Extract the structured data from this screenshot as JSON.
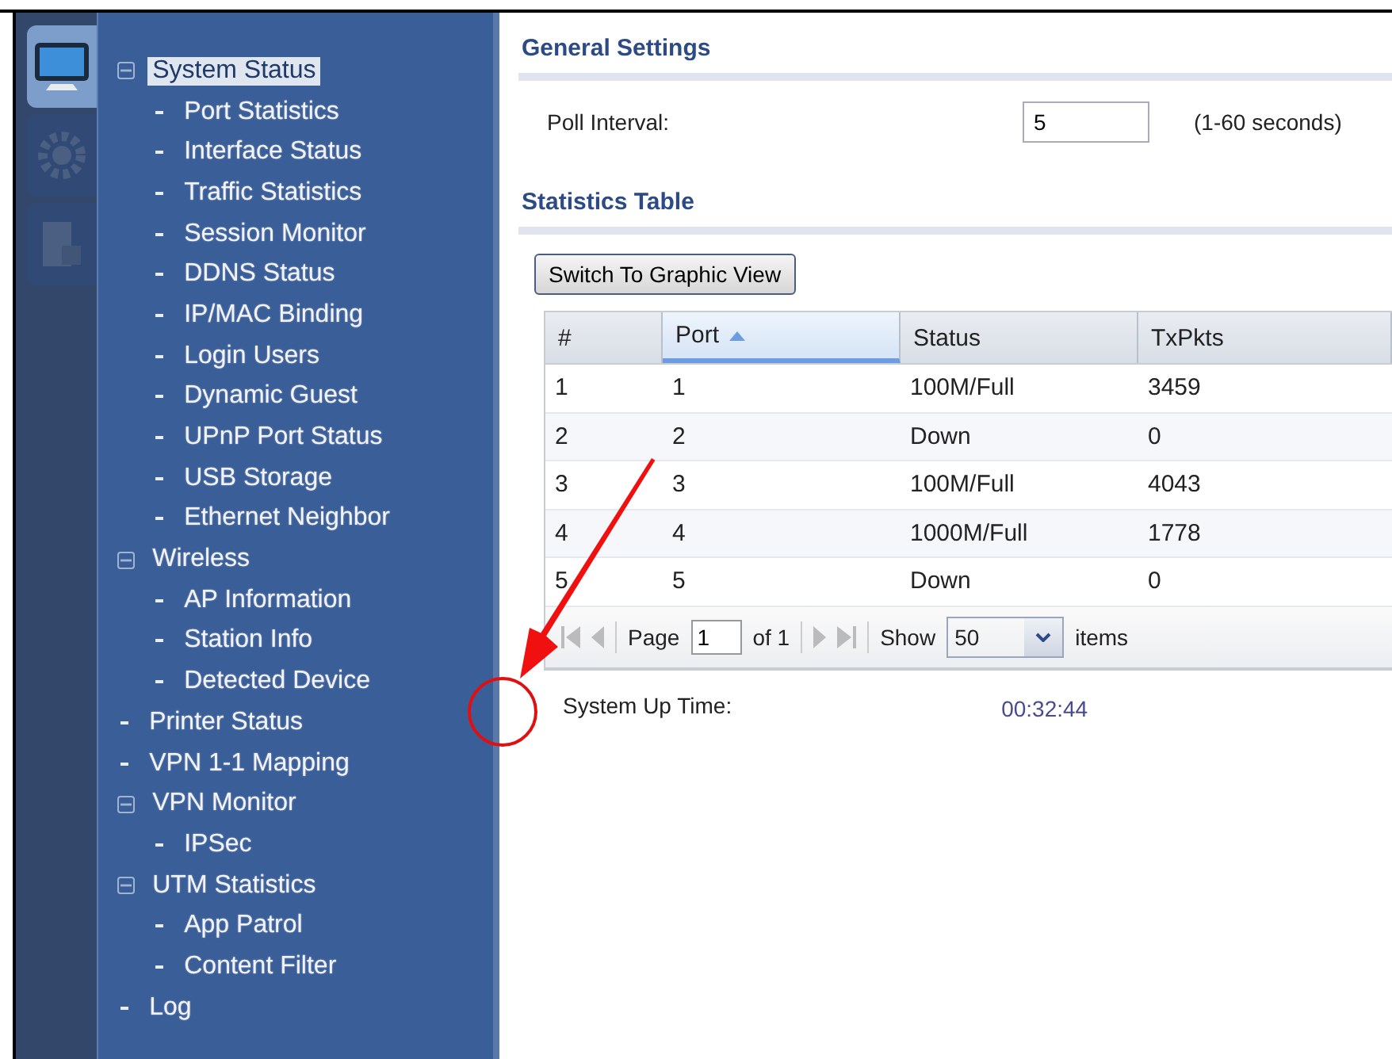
{
  "rail": [
    {
      "selected": true
    },
    {
      "selected": false
    },
    {
      "selected": false
    }
  ],
  "menu": [
    {
      "label": "System Status",
      "kind": "group",
      "expanded": true,
      "selected": true,
      "children": [
        {
          "label": "Port Statistics",
          "selected": false
        },
        {
          "label": "Interface Status",
          "selected": false
        },
        {
          "label": "Traffic Statistics",
          "selected": false
        },
        {
          "label": "Session Monitor",
          "selected": false
        },
        {
          "label": "DDNS Status",
          "selected": false
        },
        {
          "label": "IP/MAC Binding",
          "selected": false
        },
        {
          "label": "Login Users",
          "selected": false
        },
        {
          "label": "Dynamic Guest",
          "selected": false
        },
        {
          "label": "UPnP Port Status",
          "selected": false
        },
        {
          "label": "USB Storage",
          "selected": false
        },
        {
          "label": "Ethernet Neighbor",
          "selected": false
        }
      ]
    },
    {
      "label": "Wireless",
      "kind": "group",
      "expanded": true,
      "selected": false,
      "children": [
        {
          "label": "AP Information",
          "selected": false
        },
        {
          "label": "Station Info",
          "selected": false
        },
        {
          "label": "Detected Device",
          "selected": false
        }
      ]
    },
    {
      "label": "Printer Status",
      "kind": "link",
      "selected": false
    },
    {
      "label": "VPN 1-1 Mapping",
      "kind": "link",
      "selected": false
    },
    {
      "label": "VPN Monitor",
      "kind": "group",
      "expanded": true,
      "selected": false,
      "children": [
        {
          "label": "IPSec",
          "selected": false
        }
      ]
    },
    {
      "label": "UTM Statistics",
      "kind": "group",
      "expanded": true,
      "selected": false,
      "children": [
        {
          "label": "App Patrol",
          "selected": false
        },
        {
          "label": "Content Filter",
          "selected": false
        }
      ]
    },
    {
      "label": "Log",
      "kind": "link",
      "selected": false
    }
  ],
  "general_settings": {
    "title": "General Settings",
    "poll_interval": {
      "label": "Poll Interval:",
      "value": "5",
      "hint": "(1-60 seconds)"
    }
  },
  "statistics_table": {
    "title": "Statistics Table",
    "button": "Switch To Graphic View",
    "columns": [
      {
        "label": "#",
        "sorted": false
      },
      {
        "label": "Port",
        "sorted": true
      },
      {
        "label": "Status",
        "sorted": false
      },
      {
        "label": "TxPkts",
        "sorted": false
      }
    ],
    "rows": [
      [
        "1",
        "1",
        "100M/Full",
        "3459"
      ],
      [
        "2",
        "2",
        "Down",
        "0"
      ],
      [
        "3",
        "3",
        "100M/Full",
        "4043"
      ],
      [
        "4",
        "4",
        "1000M/Full",
        "1778"
      ],
      [
        "5",
        "5",
        "Down",
        "0"
      ]
    ],
    "pager": {
      "page_label": "Page",
      "page": "1",
      "of": "of 1",
      "show_label": "Show",
      "show": "50",
      "items_label": "items"
    }
  },
  "uptime": {
    "label": "System Up Time:",
    "value": "00:32:44"
  }
}
